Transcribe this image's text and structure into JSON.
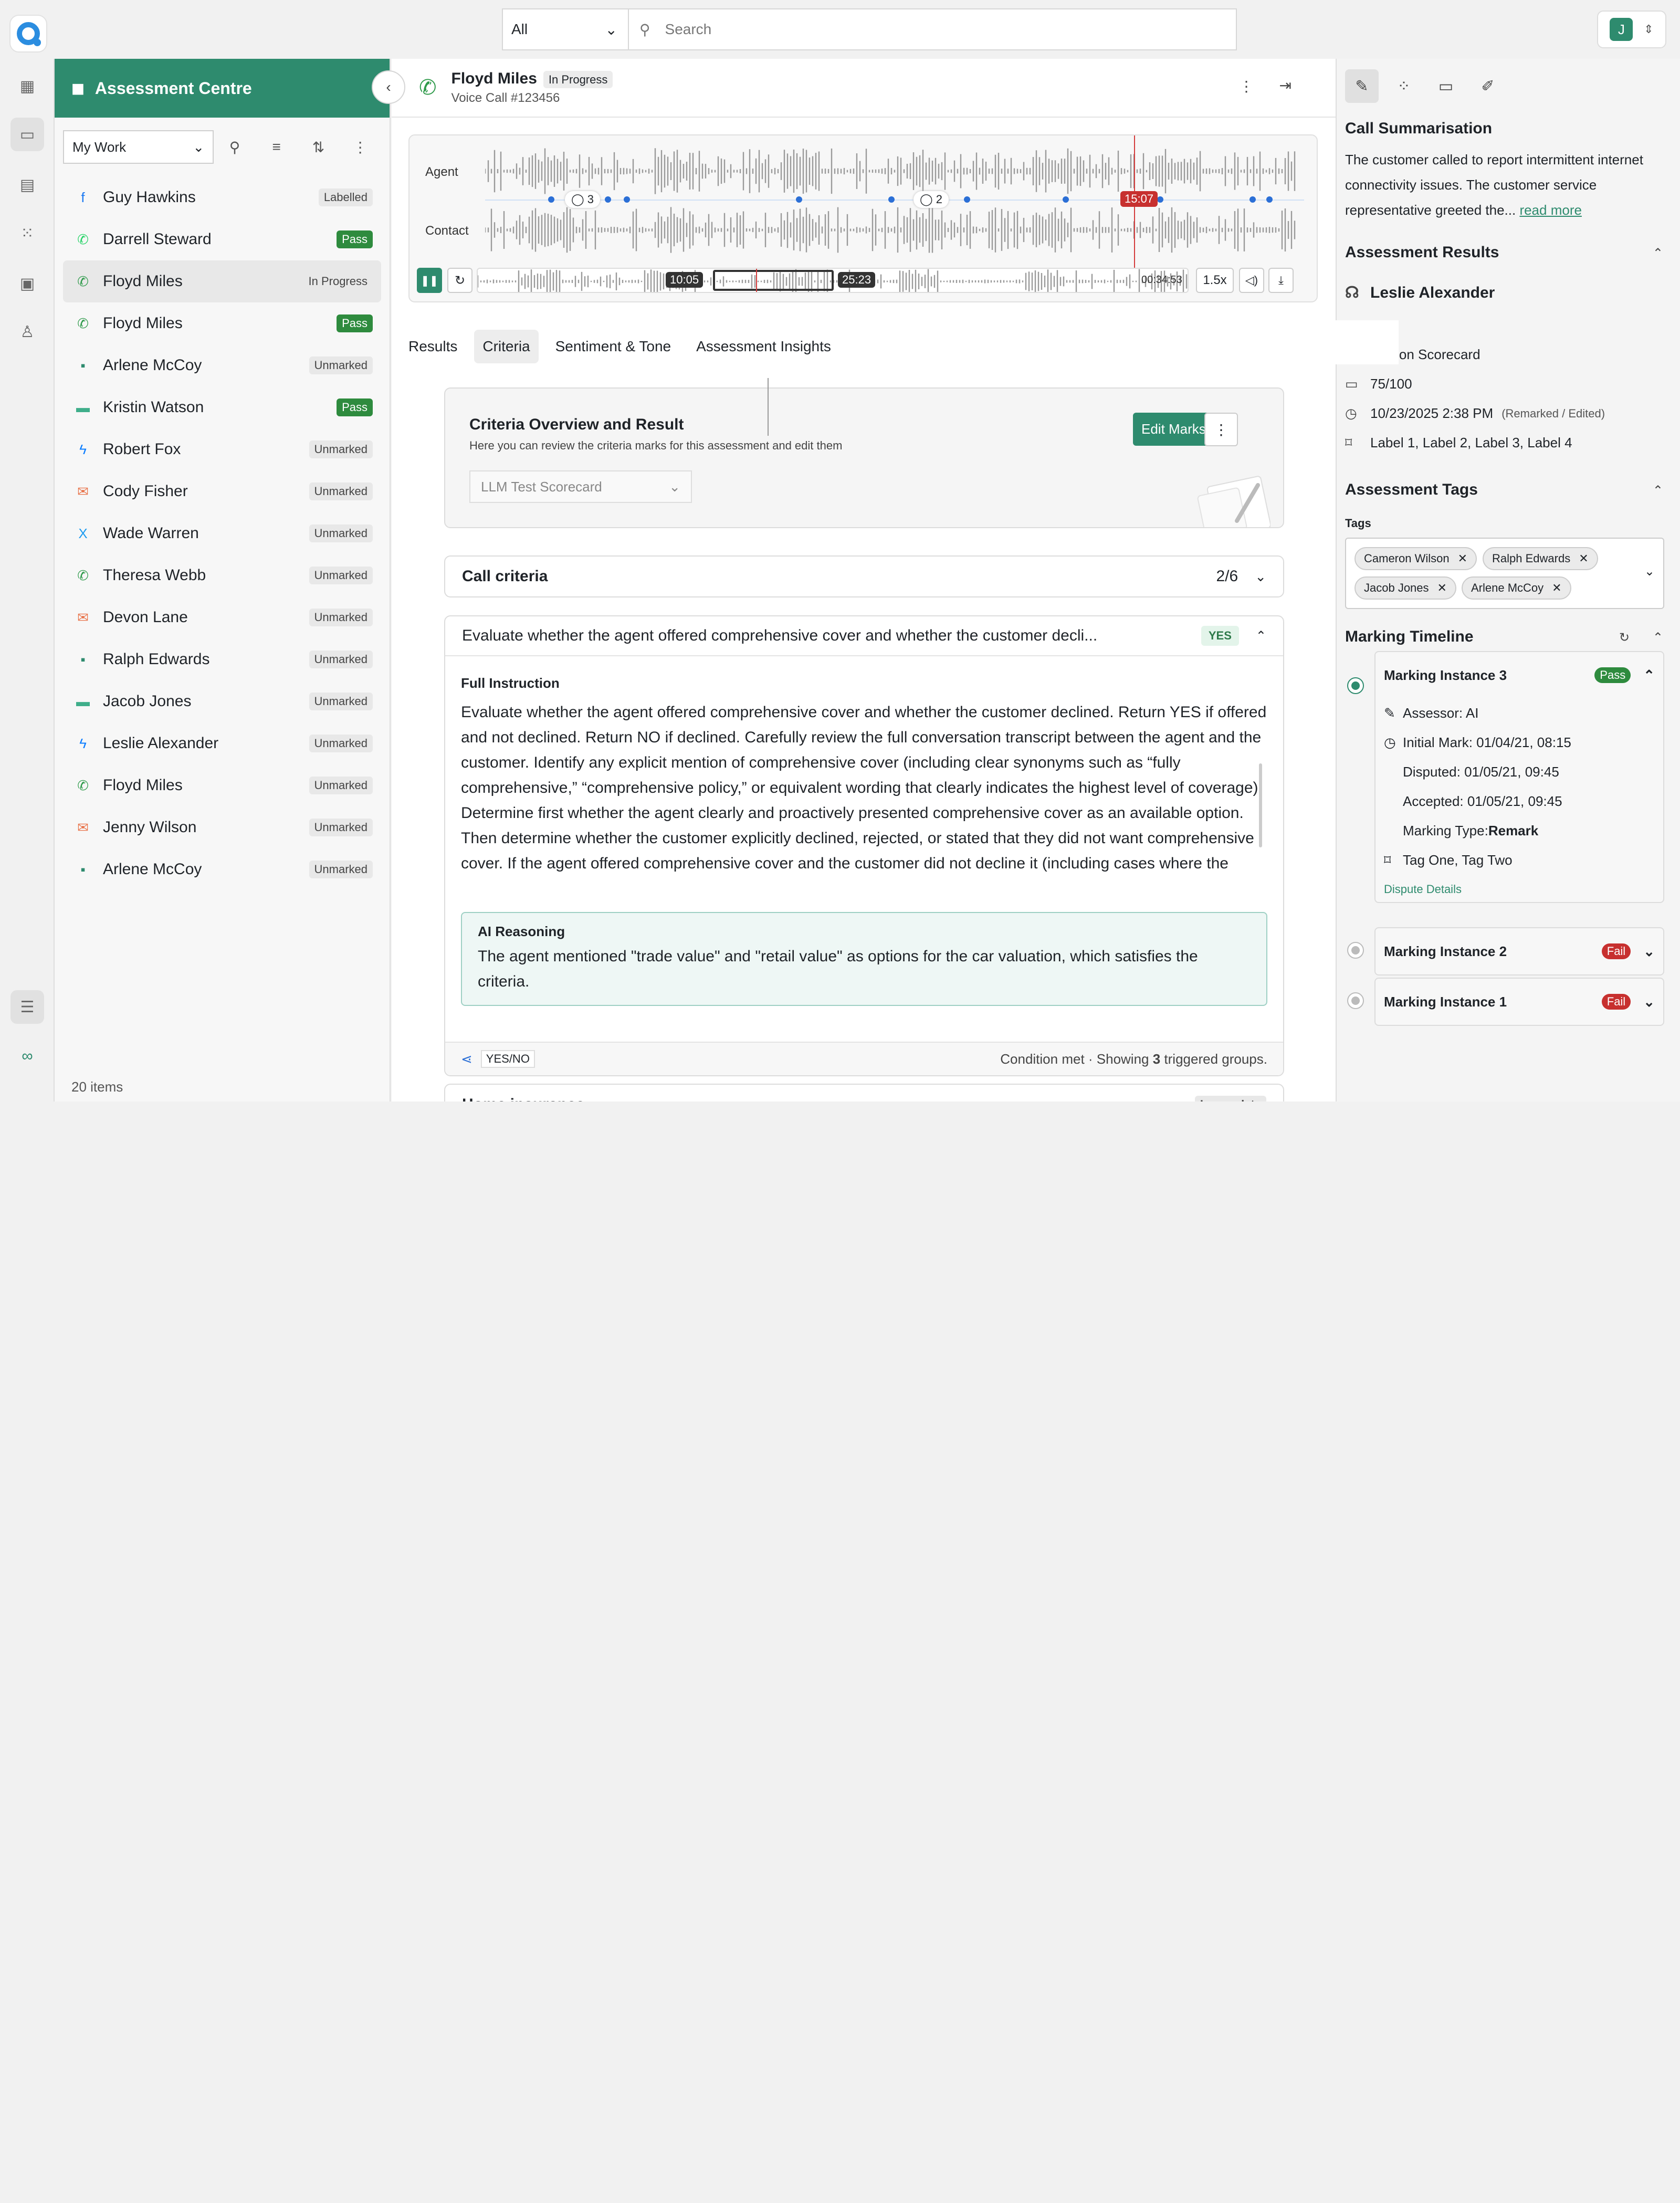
{
  "search": {
    "scope": "All",
    "placeholder": "Search"
  },
  "user": {
    "initial": "J"
  },
  "left_panel": {
    "title": "Assessment Centre",
    "filter": "My Work",
    "count": "20 items",
    "items": [
      {
        "name": "Guy Hawkins",
        "status": "Labelled",
        "channel": "facebook-icon",
        "color": "#1877f2"
      },
      {
        "name": "Darrell Steward",
        "status": "Pass",
        "channel": "whatsapp-icon",
        "color": "#25d366"
      },
      {
        "name": "Floyd Miles",
        "status": "In Progress",
        "channel": "phone-icon",
        "color": "#2e9a4a"
      },
      {
        "name": "Floyd Miles",
        "status": "Pass",
        "channel": "phone-icon",
        "color": "#2e9a4a"
      },
      {
        "name": "Arlene McCoy",
        "status": "Unmarked",
        "channel": "sms-icon",
        "color": "#2e8b6e"
      },
      {
        "name": "Kristin Watson",
        "status": "Pass",
        "channel": "chat-icon",
        "color": "#3fae8a"
      },
      {
        "name": "Robert Fox",
        "status": "Unmarked",
        "channel": "messenger-icon",
        "color": "#0a7cff"
      },
      {
        "name": "Cody Fisher",
        "status": "Unmarked",
        "channel": "email-icon",
        "color": "#e8734a"
      },
      {
        "name": "Wade Warren",
        "status": "Unmarked",
        "channel": "x-icon",
        "color": "#1d9bf0"
      },
      {
        "name": "Theresa Webb",
        "status": "Unmarked",
        "channel": "phone-icon",
        "color": "#2e9a4a"
      },
      {
        "name": "Devon Lane",
        "status": "Unmarked",
        "channel": "email-icon",
        "color": "#e8734a"
      },
      {
        "name": "Ralph Edwards",
        "status": "Unmarked",
        "channel": "sms-icon",
        "color": "#2e8b6e"
      },
      {
        "name": "Jacob Jones",
        "status": "Unmarked",
        "channel": "chat-icon",
        "color": "#3fae8a"
      },
      {
        "name": "Leslie Alexander",
        "status": "Unmarked",
        "channel": "messenger-icon",
        "color": "#0a7cff"
      },
      {
        "name": "Floyd Miles",
        "status": "Unmarked",
        "channel": "phone-icon",
        "color": "#2e9a4a"
      },
      {
        "name": "Jenny Wilson",
        "status": "Unmarked",
        "channel": "email-icon",
        "color": "#e8734a"
      },
      {
        "name": "Arlene McCoy",
        "status": "Unmarked",
        "channel": "sms-icon",
        "color": "#2e8b6e"
      }
    ]
  },
  "header": {
    "name": "Floyd Miles",
    "status": "In Progress",
    "sub": "Voice Call #123456"
  },
  "player": {
    "agent_label": "Agent",
    "contact_label": "Contact",
    "playhead_time": "15:07",
    "comment_a": "3",
    "comment_b": "2",
    "range_start": "10:05",
    "range_end": "25:23",
    "duration": "00:34:53",
    "speed": "1.5x"
  },
  "tabs": [
    "Results",
    "Criteria",
    "Sentiment & Tone",
    "Assessment Insights"
  ],
  "overview": {
    "title": "Criteria Overview and Result",
    "desc": "Here you can review the criteria marks for this assessment and edit them",
    "scorecard": "LLM Test Scorecard",
    "edit": "Edit Marks"
  },
  "call_criteria": {
    "title": "Call criteria",
    "score": "2/6"
  },
  "criterion": {
    "question": "Evaluate whether the agent offered comprehensive cover and whether the customer decli...",
    "answer": "YES",
    "full_label": "Full Instruction",
    "full_text": "Evaluate whether the agent offered comprehensive cover and whether the customer declined. Return YES if offered and not declined. Return NO if declined. Carefully review the full conversation transcript between the agent and the customer. Identify any explicit mention of comprehensive cover (including clear synonyms such as “fully comprehensive,” “comprehensive policy,” or equivalent wording that clearly indicates the highest level of coverage). Determine first whether the agent clearly and proactively presented comprehensive cover as an available option. Then determine whether the customer explicitly declined, rejected, or stated that they did not want comprehensive cover. If the agent offered comprehensive cover and the customer did not decline it (including cases where the",
    "ai_label": "AI Reasoning",
    "ai_text": "The agent mentioned \"trade value\" and \"retail value\" as options for the car valuation, which satisfies the criteria.",
    "type": "YES/NO",
    "cond_pre": "Condition met · Showing ",
    "cond_num": "3",
    "cond_post": " triggered groups."
  },
  "next_criteria": {
    "title": "Home insurance",
    "status": "Incomplete"
  },
  "right": {
    "summary_title": "Call Summarisation",
    "summary": "The customer called to report intermittent internet connectivity issues. The customer service representative greeted the...",
    "read_more": "read more",
    "results_title": "Assessment Results",
    "assessor": "Leslie Alexander",
    "scorecard": "ression Scorecard",
    "score": "75/100",
    "date": "10/23/2025 2:38 PM",
    "date_note": "(Remarked / Edited)",
    "labels": "Label 1, Label 2, Label 3, Label 4",
    "tags_title": "Assessment Tags",
    "tags_label": "Tags",
    "tags": [
      "Cameron Wilson",
      "Ralph Edwards",
      "Jacob Jones",
      "Arlene McCoy"
    ],
    "timeline_title": "Marking Timeline",
    "instances": [
      {
        "name": "Marking Instance 3",
        "result": "Pass"
      },
      {
        "name": "Marking Instance 2",
        "result": "Fail"
      },
      {
        "name": "Marking Instance 1",
        "result": "Fail"
      }
    ],
    "details": {
      "assessor": "Assessor: AI",
      "initial": "Initial Mark: 01/04/21, 08:15",
      "disputed": "Disputed: 01/05/21, 09:45",
      "accepted": "Accepted: 01/05/21, 09:45",
      "type_pre": "Marking Type: ",
      "type": "Remark",
      "tags": "Tag One, Tag Two",
      "dispute": "Dispute Details"
    }
  }
}
